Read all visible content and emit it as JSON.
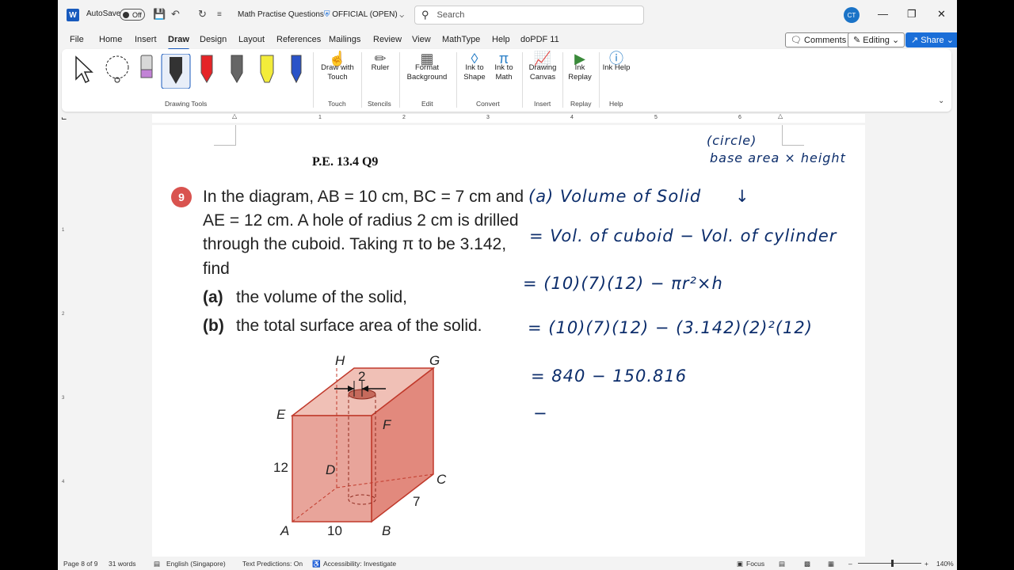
{
  "title_bar": {
    "app_logo": "W",
    "autosave_label": "AutoSave",
    "autosave_state": "Off",
    "doc_title": "Math Practise Questions",
    "sensitivity": "OFFICIAL (OPEN)",
    "search_placeholder": "Search",
    "user_initials": "CT"
  },
  "menu": {
    "tabs": [
      "File",
      "Home",
      "Insert",
      "Draw",
      "Design",
      "Layout",
      "References",
      "Mailings",
      "Review",
      "View",
      "MathType",
      "Help",
      "doPDF 11"
    ],
    "active": "Draw",
    "comments_label": "Comments",
    "editing_label": "Editing",
    "share_label": "Share"
  },
  "ribbon": {
    "draw_with_touch": "Draw with Touch",
    "ruler": "Ruler",
    "format_background": "Format Background",
    "ink_to_shape": "Ink to Shape",
    "ink_to_math": "Ink to Math",
    "drawing_canvas": "Drawing Canvas",
    "ink_replay": "Ink Replay",
    "ink_help": "Ink Help",
    "groups": {
      "drawing_tools": "Drawing Tools",
      "touch": "Touch",
      "stencils": "Stencils",
      "edit": "Edit",
      "convert": "Convert",
      "insert": "Insert",
      "replay": "Replay",
      "help": "Help"
    }
  },
  "ruler": {
    "numbers": [
      "1",
      "2",
      "3",
      "4",
      "5",
      "6"
    ],
    "v_numbers": [
      "1",
      "2",
      "3",
      "4"
    ]
  },
  "document": {
    "heading": "P.E. 13.4 Q9",
    "question_number": "9",
    "lines": [
      "In the diagram, AB = 10 cm, BC = 7 cm and",
      "AE = 12 cm. A hole of radius 2 cm is drilled",
      "through the cuboid. Taking π to be 3.142,",
      "find"
    ],
    "parts": [
      {
        "label": "(a)",
        "text": "the volume of the solid,"
      },
      {
        "label": "(b)",
        "text": "the total surface area of the solid."
      }
    ],
    "diagram": {
      "labels": {
        "H": "H",
        "G": "G",
        "E": "E",
        "F": "F",
        "D": "D",
        "C": "C",
        "A": "A",
        "B": "B",
        "ab": "10",
        "bc": "7",
        "ae": "12",
        "hole": "2"
      }
    },
    "handwriting": [
      "(circle)",
      "base area × height",
      "(a) Volume of Solid",
      "↓",
      "= Vol. of cuboid − Vol. of cylinder",
      "= (10)(7)(12) − πr²×h",
      "= (10)(7)(12) − (3.142)(2)²(12)",
      "= 840 − 150.816",
      "−"
    ]
  },
  "status_bar": {
    "page": "Page 8 of 9",
    "words": "31 words",
    "language": "English (Singapore)",
    "text_predictions": "Text Predictions: On",
    "accessibility": "Accessibility: Investigate",
    "focus": "Focus",
    "zoom": "140%"
  },
  "colors": {
    "accent": "#185abd",
    "cuboid_face": "#e8a49a",
    "cuboid_front": "#e2897d",
    "badge": "#d9534f",
    "ink": "#0c2d6b"
  }
}
